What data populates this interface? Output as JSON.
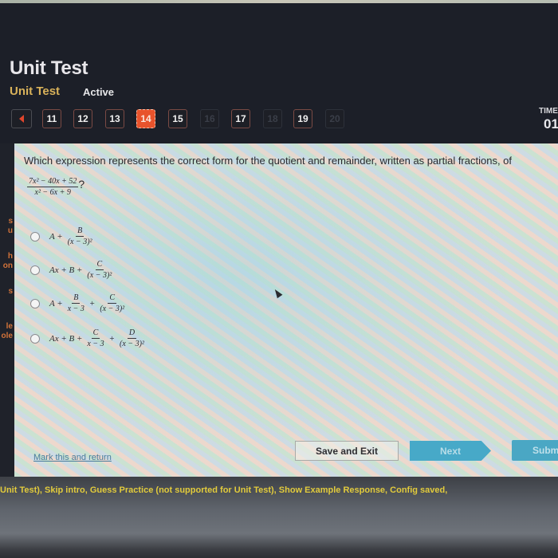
{
  "header": {
    "title": "Unit Test",
    "subtitle": "Unit Test",
    "status": "Active"
  },
  "question_nav": {
    "prev_icon": "chevron-left-icon",
    "items": [
      {
        "label": "11",
        "state": "normal"
      },
      {
        "label": "12",
        "state": "normal"
      },
      {
        "label": "13",
        "state": "normal"
      },
      {
        "label": "14",
        "state": "current"
      },
      {
        "label": "15",
        "state": "normal"
      },
      {
        "label": "16",
        "state": "disabled"
      },
      {
        "label": "17",
        "state": "normal"
      },
      {
        "label": "18",
        "state": "disabled"
      },
      {
        "label": "19",
        "state": "normal"
      },
      {
        "label": "20",
        "state": "disabled"
      }
    ],
    "current_color": "#e8532c"
  },
  "timer": {
    "label": "TIME",
    "value": "01"
  },
  "sidebar": {
    "items": [
      {
        "label": "s"
      },
      {
        "label": "u"
      },
      {
        "label": "h"
      },
      {
        "label": "on"
      },
      {
        "label": "s"
      },
      {
        "label": "le"
      },
      {
        "label": "ole"
      }
    ]
  },
  "question": {
    "text": "Which expression represents the correct form for the quotient and remainder, written as partial fractions, of",
    "expression": {
      "numerator": "7x² − 40x + 52",
      "denominator": "x² − 6x + 9",
      "suffix": "?"
    }
  },
  "options": [
    {
      "terms": [
        {
          "type": "text",
          "value": "A +"
        },
        {
          "type": "frac",
          "num": "B",
          "den": "(x − 3)²"
        }
      ]
    },
    {
      "terms": [
        {
          "type": "text",
          "value": "Ax + B +"
        },
        {
          "type": "frac",
          "num": "C",
          "den": "(x − 3)²"
        }
      ]
    },
    {
      "terms": [
        {
          "type": "text",
          "value": "A +"
        },
        {
          "type": "frac",
          "num": "B",
          "den": "x − 3"
        },
        {
          "type": "text",
          "value": "+"
        },
        {
          "type": "frac",
          "num": "C",
          "den": "(x − 3)²"
        }
      ]
    },
    {
      "terms": [
        {
          "type": "text",
          "value": "Ax + B +"
        },
        {
          "type": "frac",
          "num": "C",
          "den": "x − 3"
        },
        {
          "type": "text",
          "value": "+"
        },
        {
          "type": "frac",
          "num": "D",
          "den": "(x − 3)²"
        }
      ]
    }
  ],
  "actions": {
    "mark_label": "Mark this and return",
    "save_label": "Save and Exit",
    "next_label": "Next",
    "submit_label": "Submit",
    "accent_color": "#47a9c8"
  },
  "footer": {
    "debug_text": "Unit Test), Skip intro, Guess Practice (not supported for Unit Test), Show Example Response, Config saved,"
  }
}
